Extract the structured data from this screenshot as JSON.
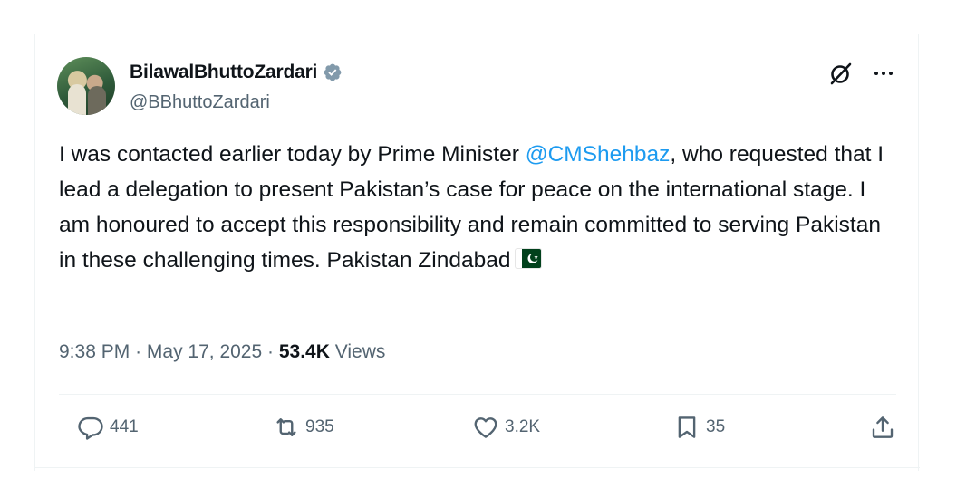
{
  "author": {
    "display_name": "BilawalBhuttoZardari",
    "handle": "@BBhuttoZardari",
    "verified_icon": "verified-badge-icon",
    "verified_color": "#829aab"
  },
  "tweet": {
    "text_before_mention": "I was contacted earlier today by Prime Minister ",
    "mention": "@CMShehbaz",
    "text_after_mention": ", who requested that I lead a delegation to present Pakistan’s case for peace on the international stage. I am honoured to accept this responsibility and remain committed to serving Pakistan in these challenging times. Pakistan Zindabad",
    "emoji": "pakistan-flag-emoji",
    "mention_color": "#1d9bf0"
  },
  "meta": {
    "time": "9:38 PM",
    "separator": "·",
    "date": "May 17, 2025",
    "views_count": "53.4K",
    "views_label": "Views"
  },
  "actions": {
    "replies": "441",
    "reposts": "935",
    "likes": "3.2K",
    "bookmarks": "35"
  },
  "colors": {
    "secondary_text": "#536471",
    "primary_text": "#0f1419",
    "divider": "#eff3f4"
  }
}
